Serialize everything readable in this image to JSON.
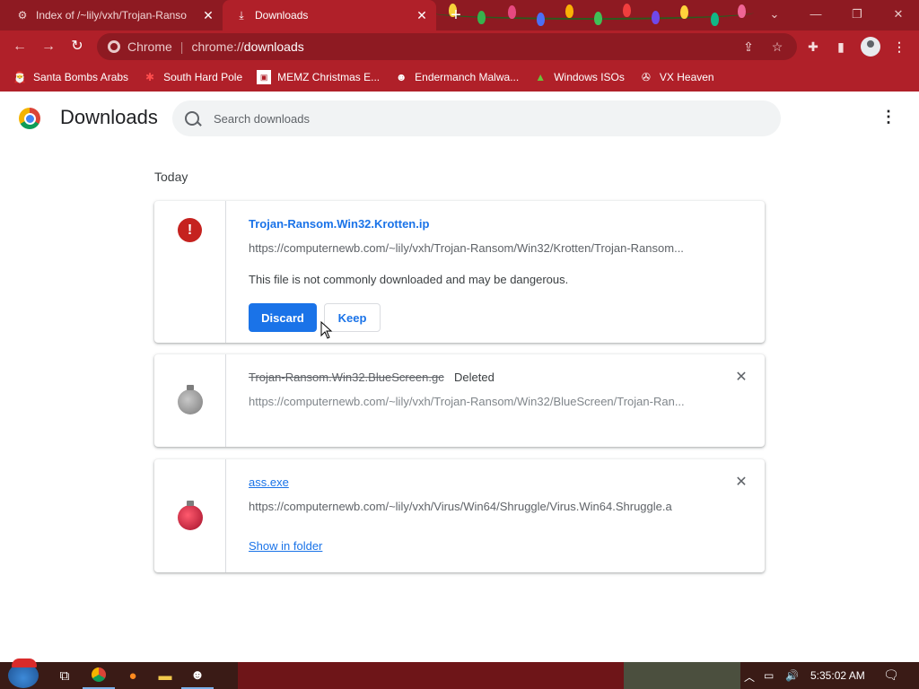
{
  "tabs": [
    {
      "title": "Index of /~lily/vxh/Trojan-Ranso",
      "icon": "site-favicon"
    },
    {
      "title": "Downloads",
      "icon": "download-icon"
    }
  ],
  "address_bar": {
    "site": "Chrome",
    "url_prefix": "chrome://",
    "url_path": "downloads"
  },
  "bookmarks": [
    {
      "label": "Santa Bombs Arabs",
      "icon": "santa-icon"
    },
    {
      "label": "South Hard Pole",
      "icon": "snowflake-icon"
    },
    {
      "label": "MEMZ Christmas E...",
      "icon": "memz-icon"
    },
    {
      "label": "Endermanch Malwa...",
      "icon": "raccoon-icon"
    },
    {
      "label": "Windows ISOs",
      "icon": "tree-icon"
    },
    {
      "label": "VX Heaven",
      "icon": "vx-icon"
    }
  ],
  "page": {
    "title": "Downloads",
    "search_placeholder": "Search downloads",
    "section": "Today"
  },
  "downloads": [
    {
      "file_name": "Trojan-Ransom.Win32.Krotten.ip",
      "url": "https://computernewb.com/~lily/vxh/Trojan-Ransom/Win32/Krotten/Trojan-Ransom...",
      "warning": "This file is not commonly downloaded and may be dangerous.",
      "discard_label": "Discard",
      "keep_label": "Keep"
    },
    {
      "file_name": "Trojan-Ransom.Win32.BlueScreen.gc",
      "status": "Deleted",
      "url": "https://computernewb.com/~lily/vxh/Trojan-Ransom/Win32/BlueScreen/Trojan-Ran..."
    },
    {
      "file_name": "ass.exe",
      "url": "https://computernewb.com/~lily/vxh/Virus/Win64/Shruggle/Virus.Win64.Shruggle.a",
      "show_in_folder_label": "Show in folder"
    }
  ],
  "taskbar": {
    "clock": "5:35:02 AM"
  },
  "colors": {
    "theme_dark": "#8e1a22",
    "theme": "#b02029",
    "accent": "#1a73e8",
    "danger": "#c5221f"
  }
}
